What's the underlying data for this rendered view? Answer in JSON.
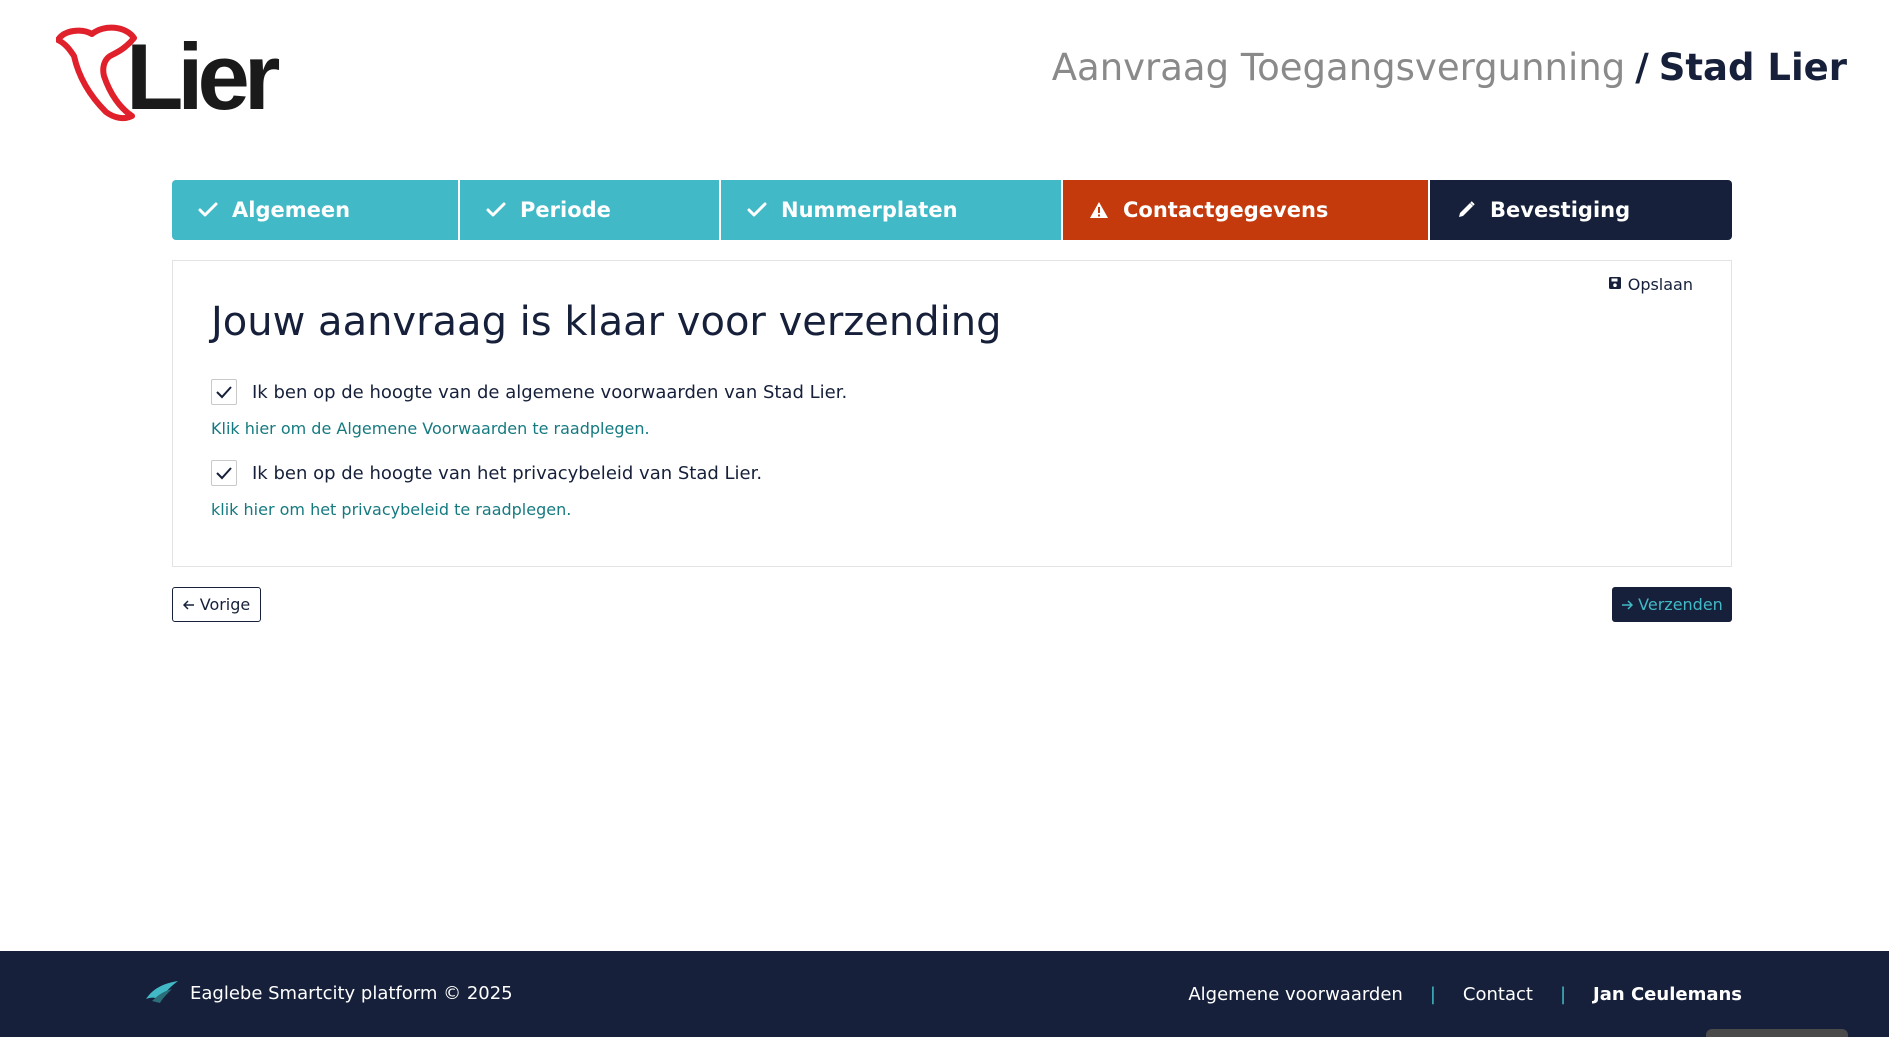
{
  "header": {
    "logo_text": "Lier",
    "title_light": "Aanvraag Toegangsvergunning",
    "title_separator": "/",
    "title_strong": "Stad Lier"
  },
  "steps": [
    {
      "label": "Algemeen",
      "status": "done",
      "icon": "check-icon"
    },
    {
      "label": "Periode",
      "status": "done",
      "icon": "check-icon"
    },
    {
      "label": "Nummerplaten",
      "status": "done",
      "icon": "check-icon"
    },
    {
      "label": "Contactgegevens",
      "status": "warning",
      "icon": "warning-icon"
    },
    {
      "label": "Bevestiging",
      "status": "active",
      "icon": "pencil-icon"
    }
  ],
  "card": {
    "save_label": "Opslaan",
    "title": "Jouw aanvraag is klaar voor verzending",
    "terms_label": "Ik ben op de hoogte van de algemene voorwaarden van Stad Lier.",
    "terms_checked": true,
    "terms_link": "Klik hier om de Algemene Voorwaarden te raadplegen.",
    "privacy_label": "Ik ben op de hoogte van het privacybeleid van Stad Lier.",
    "privacy_checked": true,
    "privacy_link": "klik hier om het privacybeleid te raadplegen."
  },
  "nav": {
    "prev_label": "Vorige",
    "send_label": "Verzenden"
  },
  "footer": {
    "brand": "Eaglebe Smartcity platform © 2025",
    "links": [
      "Algemene voorwaarden",
      "Contact"
    ],
    "separator": "|",
    "user": "Jan Ceulemans"
  },
  "colors": {
    "navy": "#16203a",
    "teal": "#42b9c6",
    "orange": "#c43a0c",
    "logo_red": "#e0202a",
    "link": "#157a80"
  }
}
